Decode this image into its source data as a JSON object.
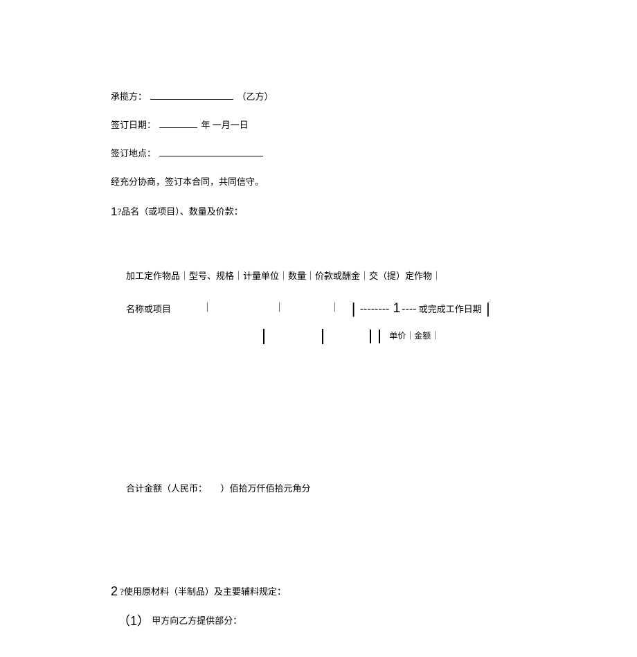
{
  "contractor": {
    "label": "承揽方：",
    "party": "（乙方）"
  },
  "sign_date": {
    "label": "签订日期：",
    "suffix": "年 一月一日"
  },
  "sign_place": {
    "label": "签订地点："
  },
  "preamble": "经充分协商，签订本合同，共同信守。",
  "section1": {
    "num": "1",
    "q": "?",
    "title": "品名（或项目）、数量及价款："
  },
  "table": {
    "header": "加工定作物品｜型号、规格｜计量单位｜数量｜价款或酬金｜交（提）定作物｜",
    "row2_left": "名称或项目",
    "row2_right": "或完成工作日期",
    "price_label": "单价｜金额｜"
  },
  "total": "合计金额（人民币：　　）佰拾万仟佰拾元角分",
  "section2": {
    "num": "2",
    "q": " ?",
    "title": "使用原材料（半制品）及主要辅料规定：",
    "sub1_num": "（1）",
    "sub1_text": "甲方向乙方提供部分："
  }
}
